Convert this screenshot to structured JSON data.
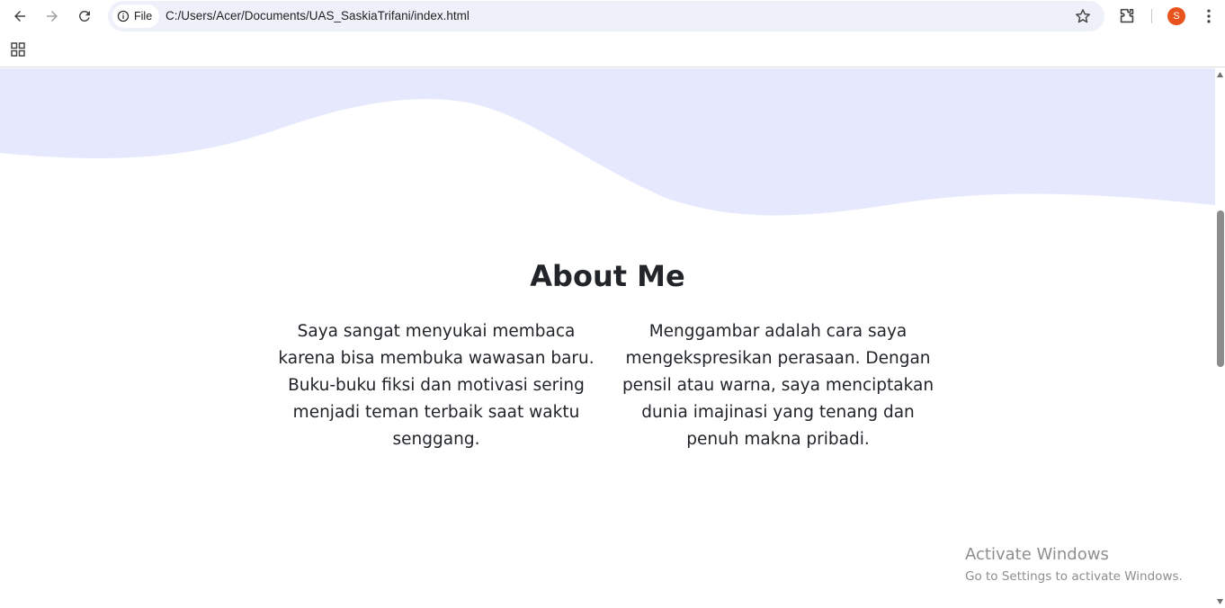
{
  "browser": {
    "site_chip_label": "File",
    "url": "C:/Users/Acer/Documents/UAS_SaskiaTrifani/index.html",
    "profile_initial": "S"
  },
  "icons": {
    "back": "back-arrow-icon",
    "forward": "forward-arrow-icon",
    "reload": "reload-icon",
    "site_info": "info-icon",
    "bookmark": "star-icon",
    "extensions": "puzzle-icon",
    "menu": "kebab-menu-icon",
    "apps": "apps-grid-icon"
  },
  "colors": {
    "wave_fill": "#e6e9fd",
    "text": "#212529",
    "avatar": "#e8541c"
  },
  "page": {
    "about_title": "About Me",
    "left_paragraph": "Saya sangat menyukai membaca karena bisa membuka wawasan baru. Buku-buku fiksi dan motivasi sering menjadi teman terbaik saat waktu senggang.",
    "right_paragraph": "Menggambar adalah cara saya mengekspresikan perasaan. Dengan pensil atau warna, saya menciptakan dunia imajinasi yang tenang dan penuh makna pribadi."
  },
  "watermark": {
    "title": "Activate Windows",
    "subtitle": "Go to Settings to activate Windows."
  }
}
